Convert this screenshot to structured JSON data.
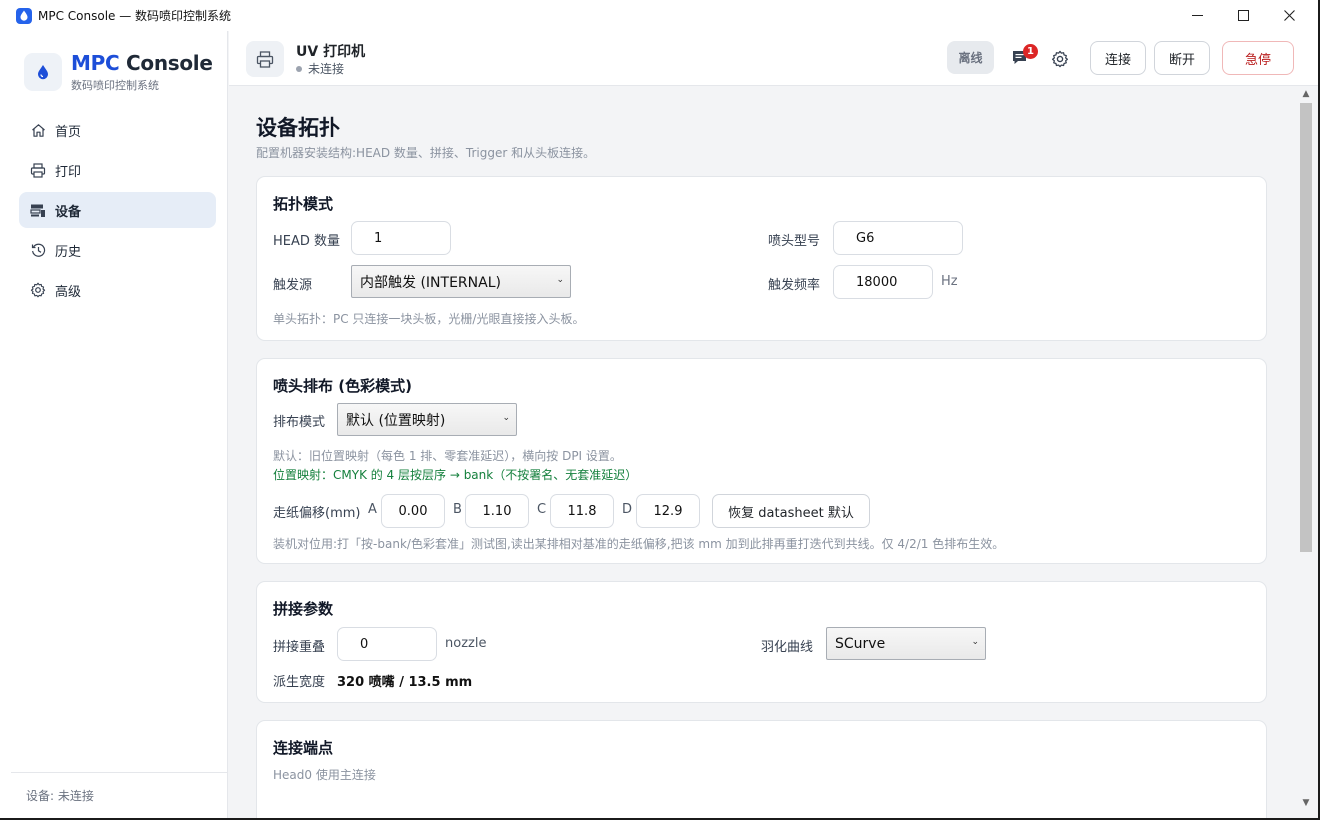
{
  "window": {
    "title": "MPC Console — 数码喷印控制系统",
    "minimize": "—",
    "maximize": "☐",
    "close": "✕"
  },
  "brand": {
    "title_accent": "MPC",
    "title_rest": " Console",
    "subtitle": "数码喷印控制系统"
  },
  "nav": {
    "items": [
      {
        "label": "首页",
        "icon": "home-icon"
      },
      {
        "label": "打印",
        "icon": "printer-icon"
      },
      {
        "label": "设备",
        "icon": "device-icon",
        "active": true
      },
      {
        "label": "历史",
        "icon": "history-icon"
      },
      {
        "label": "高级",
        "icon": "gear-icon"
      }
    ]
  },
  "sidebar_footer": "设备: 未连接",
  "header": {
    "device_name": "UV 打印机",
    "device_status": "未连接",
    "offline": "离线",
    "notification_count": "1",
    "connect": "连接",
    "disconnect": "断开",
    "estop": "急停"
  },
  "page": {
    "title": "设备拓扑",
    "subtitle": "配置机器安装结构:HEAD 数量、拼接、Trigger 和从头板连接。"
  },
  "topology": {
    "title": "拓扑模式",
    "head_count_label": "HEAD 数量",
    "head_count": "1",
    "head_model_label": "喷头型号",
    "head_model": "G6",
    "trigger_label": "触发源",
    "trigger_value": "内部触发 (INTERNAL)",
    "trigger_freq_label": "触发频率",
    "trigger_freq": "18000",
    "freq_unit": "Hz",
    "hint": "单头拓扑：PC 只连接一块头板，光栅/光眼直接接入头板。"
  },
  "layout": {
    "title": "喷头排布 (色彩模式)",
    "mode_label": "排布模式",
    "mode_value": "默认 (位置映射)",
    "hint1": "默认：旧位置映射（每色 1 排、零套准延迟），横向按 DPI 设置。",
    "hint2": "位置映射：CMYK 的 4 层按层序 → bank（不按署名、无套准延迟）",
    "offset_label": "走纸偏移(mm)",
    "offsets": [
      {
        "key": "A",
        "value": "0.00"
      },
      {
        "key": "B",
        "value": "1.10"
      },
      {
        "key": "C",
        "value": "11.8"
      },
      {
        "key": "D",
        "value": "12.9"
      }
    ],
    "reset_button": "恢复 datasheet 默认",
    "hint3": "装机对位用:打「按-bank/色彩套准」测试图,读出某排相对基准的走纸偏移,把该 mm 加到此排再重打迭代到共线。仅 4/2/1 色排布生效。"
  },
  "stitch": {
    "title": "拼接参数",
    "overlap_label": "拼接重叠",
    "overlap": "0",
    "overlap_unit": "nozzle",
    "feather_label": "羽化曲线",
    "feather_value": "SCurve",
    "derived_label": "派生宽度",
    "derived_value": "320 喷嘴 / 13.5 mm"
  },
  "endpoint": {
    "title": "连接端点",
    "hint": "Head0 使用主连接"
  }
}
